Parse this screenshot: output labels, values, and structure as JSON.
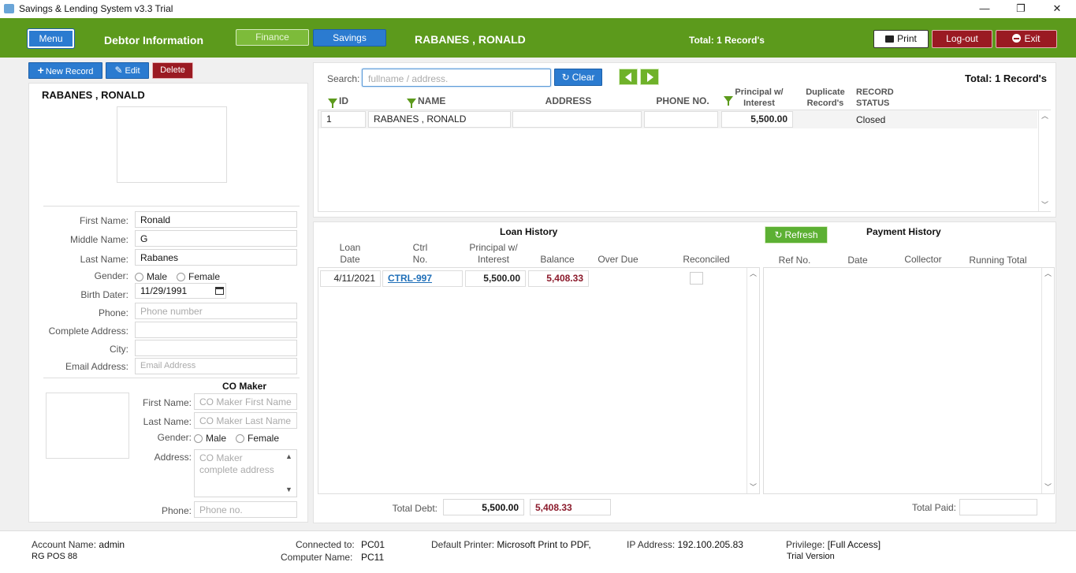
{
  "window": {
    "title": "Savings & Lending System v3.3 Trial",
    "min": "—",
    "max": "❐",
    "close": "✕"
  },
  "header": {
    "menu": "Menu",
    "section_title": "Debtor Information",
    "finance": "Finance",
    "savings": "Savings",
    "debtor_name": "RABANES , RONALD",
    "total": "Total: 1 Record's",
    "print": "Print",
    "logout": "Log-out",
    "exit": "Exit"
  },
  "actions": {
    "new_record": "New Record",
    "edit": "Edit",
    "delete": "Delete"
  },
  "profile": {
    "name": "RABANES , RONALD",
    "first_name_label": "First Name:",
    "first_name": "Ronald",
    "middle_name_label": "Middle Name:",
    "middle_name": "G",
    "last_name_label": "Last Name:",
    "last_name": "Rabanes",
    "gender_label": "Gender:",
    "male": "Male",
    "female": "Female",
    "birth_label": "Birth Dater:",
    "birth": "11/29/1991",
    "phone_label": "Phone:",
    "phone_ph": "Phone number",
    "address_label": "Complete Address:",
    "city_label": "City:",
    "email_label": "Email Address:",
    "email_ph": "Email Address"
  },
  "co_maker": {
    "title": "CO Maker",
    "first_label": "First Name:",
    "first_ph": "CO Maker First Name",
    "last_label": "Last Name:",
    "last_ph": "CO Maker Last Name",
    "gender_label": "Gender:",
    "male": "Male",
    "female": "Female",
    "address_label": "Address:",
    "address_ph": "CO Maker complete address",
    "phone_label": "Phone:",
    "phone_ph": "Phone no."
  },
  "search": {
    "label": "Search:",
    "placeholder": "fullname / address.",
    "clear": "Clear",
    "total": "Total: 1 Record's"
  },
  "records_table": {
    "headers": {
      "id": "ID",
      "name": "NAME",
      "address": "ADDRESS",
      "phone": "PHONE NO.",
      "principal": "Principal w/ Interest",
      "duplicate": "Duplicate Record's",
      "status": "RECORD STATUS"
    },
    "rows": [
      {
        "id": "1",
        "name": "RABANES , RONALD",
        "address": "",
        "phone": "",
        "principal": "5,500.00",
        "status": "Closed"
      }
    ]
  },
  "loan_history": {
    "title": "Loan History",
    "headers": {
      "date": "Loan Date",
      "ctrl": "Ctrl No.",
      "principal": "Principal w/ Interest",
      "balance": "Balance",
      "overdue": "Over Due",
      "reconciled": "Reconciled"
    },
    "rows": [
      {
        "date": "4/11/2021",
        "ctrl": "CTRL-997",
        "principal": "5,500.00",
        "balance": "5,408.33"
      }
    ],
    "total_label": "Total Debt:",
    "total_debt": "5,500.00",
    "total_balance": "5,408.33"
  },
  "payment_history": {
    "title": "Payment History",
    "refresh": "Refresh",
    "headers": {
      "ref": "Ref No.",
      "date": "Date",
      "collector": "Collector",
      "running": "Running Total"
    },
    "total_label": "Total Paid:"
  },
  "footer": {
    "account_label": "Account Name:",
    "account": "admin",
    "pos": "RG POS 88",
    "connected_label": "Connected to:",
    "connected": "PC01",
    "computer_label": "Computer Name:",
    "computer": "PC11",
    "printer_label": "Default Printer:",
    "printer": "Microsoft Print to PDF,",
    "ip_label": "IP Address:",
    "ip": "192.100.205.83",
    "privilege_label": "Privilege:",
    "privilege": "[Full Access]",
    "trial": "Trial Version"
  },
  "colors": {
    "header_green": "#5c9a1c",
    "accent_blue": "#2b7bd0",
    "danger_red": "#9a1a22",
    "balance_red": "#8b1a2b"
  }
}
